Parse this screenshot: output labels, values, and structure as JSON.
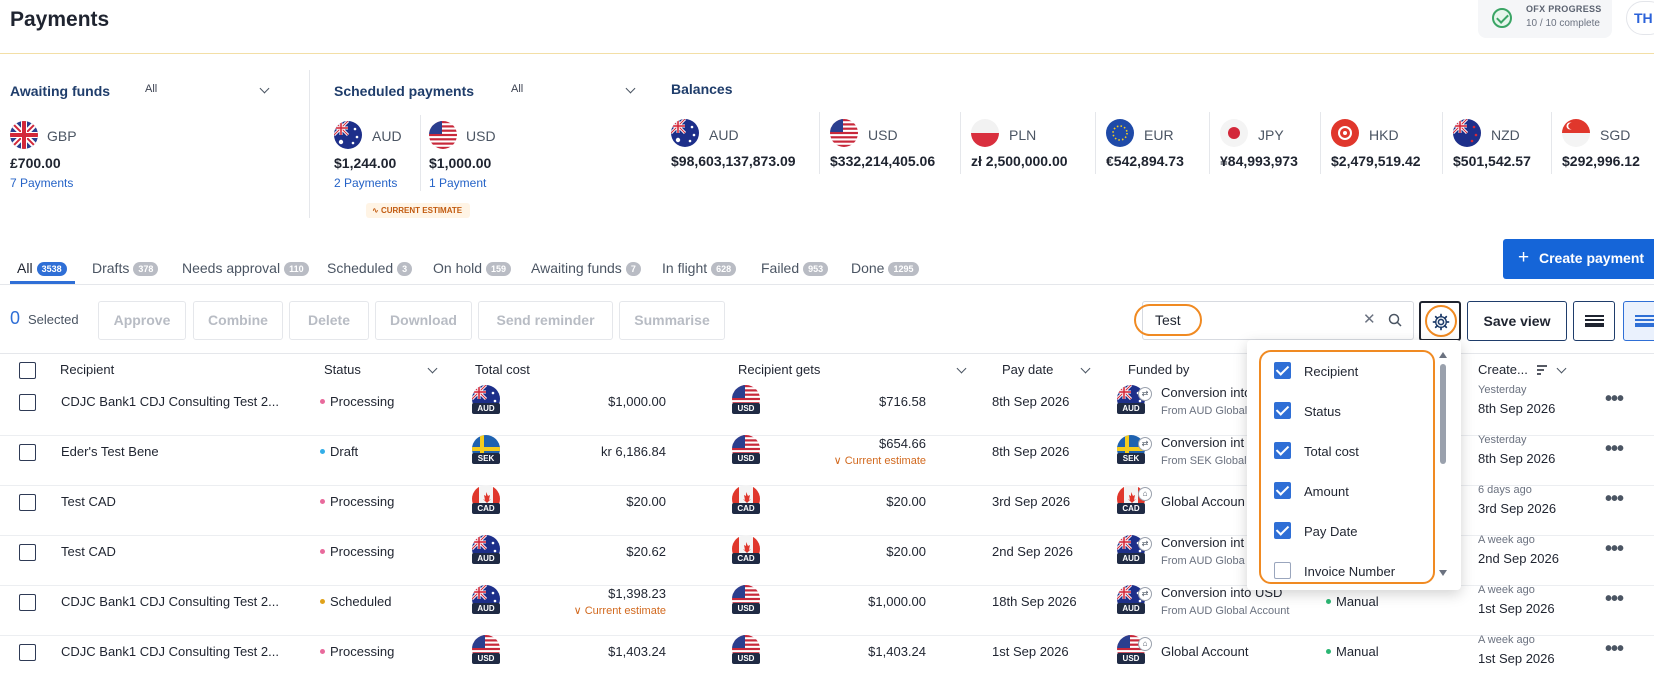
{
  "header": {
    "title": "Payments",
    "progress_title": "OFX PROGRESS",
    "progress_sub": "10 / 10 complete",
    "avatar": "TH"
  },
  "awaiting": {
    "label": "Awaiting funds",
    "filter": "All",
    "items": [
      {
        "currency": "GBP",
        "amount": "£700.00",
        "link": "7 Payments"
      }
    ]
  },
  "scheduled": {
    "label": "Scheduled payments",
    "filter": "All",
    "items": [
      {
        "currency": "AUD",
        "amount": "$1,244.00",
        "link": "2 Payments"
      },
      {
        "currency": "USD",
        "amount": "$1,000.00",
        "link": "1 Payment"
      }
    ],
    "estimate_badge": "CURRENT ESTIMATE"
  },
  "balances": {
    "label": "Balances",
    "items": [
      {
        "currency": "AUD",
        "amount": "$98,603,137,873.09"
      },
      {
        "currency": "USD",
        "amount": "$332,214,405.06"
      },
      {
        "currency": "PLN",
        "amount": "zł 2,500,000.00"
      },
      {
        "currency": "EUR",
        "amount": "€542,894.73"
      },
      {
        "currency": "JPY",
        "amount": "¥84,993,973"
      },
      {
        "currency": "HKD",
        "amount": "$2,479,519.42"
      },
      {
        "currency": "NZD",
        "amount": "$501,542.57"
      },
      {
        "currency": "SGD",
        "amount": "$292,996.12"
      }
    ]
  },
  "tabs": [
    {
      "label": "All",
      "count": "3538"
    },
    {
      "label": "Drafts",
      "count": "378"
    },
    {
      "label": "Needs approval",
      "count": "110"
    },
    {
      "label": "Scheduled",
      "count": "3"
    },
    {
      "label": "On hold",
      "count": "159"
    },
    {
      "label": "Awaiting funds",
      "count": "7"
    },
    {
      "label": "In flight",
      "count": "628"
    },
    {
      "label": "Failed",
      "count": "953"
    },
    {
      "label": "Done",
      "count": "1295"
    }
  ],
  "create_button": "Create payment",
  "toolbar": {
    "selected_count": "0",
    "selected_label": "Selected",
    "actions": [
      "Approve",
      "Combine",
      "Delete",
      "Download",
      "Send reminder",
      "Summarise"
    ],
    "search_value": "Test",
    "save_view": "Save view"
  },
  "columns": {
    "recipient": "Recipient",
    "status": "Status",
    "total_cost": "Total cost",
    "recipient_gets": "Recipient gets",
    "pay_date": "Pay date",
    "funded_by": "Funded by",
    "created": "Create..."
  },
  "column_menu": [
    {
      "label": "Recipient",
      "checked": true
    },
    {
      "label": "Status",
      "checked": true
    },
    {
      "label": "Total cost",
      "checked": true
    },
    {
      "label": "Amount",
      "checked": true
    },
    {
      "label": "Pay Date",
      "checked": true
    },
    {
      "label": "Invoice Number",
      "checked": false
    }
  ],
  "rows": [
    {
      "recipient": "CDJC Bank1 CDJ Consulting Test 2...",
      "status": "Processing",
      "status_color": "#e86a9c",
      "cost_ccy": "AUD",
      "cost": "$1,000.00",
      "cost_est": "",
      "gets_ccy": "USD",
      "gets": "$716.58",
      "gets_est": "",
      "pay_date": "8th Sep 2026",
      "funded_ccy": "AUD",
      "funded_icon": "exchange-icon",
      "funded": "Conversion into",
      "funded_sub": "From AUD Global",
      "funding_method": "",
      "created_rel": "Yesterday",
      "created_date": "8th Sep 2026"
    },
    {
      "recipient": "Eder's Test Bene",
      "status": "Draft",
      "status_color": "#33aee8",
      "cost_ccy": "SEK",
      "cost": "kr 6,186.84",
      "cost_est": "",
      "gets_ccy": "USD",
      "gets": "$654.66",
      "gets_est": "Current estimate",
      "pay_date": "8th Sep 2026",
      "funded_ccy": "SEK",
      "funded_icon": "exchange-icon",
      "funded": "Conversion int",
      "funded_sub": "From SEK Global",
      "funding_method": "",
      "created_rel": "Yesterday",
      "created_date": "8th Sep 2026"
    },
    {
      "recipient": "Test CAD",
      "status": "Processing",
      "status_color": "#e86a9c",
      "cost_ccy": "CAD",
      "cost": "$20.00",
      "cost_est": "",
      "gets_ccy": "CAD",
      "gets": "$20.00",
      "gets_est": "",
      "pay_date": "3rd Sep 2026",
      "funded_ccy": "CAD",
      "funded_icon": "bank-icon",
      "funded": "Global Accoun",
      "funded_sub": "",
      "funding_method": "",
      "created_rel": "6 days ago",
      "created_date": "3rd Sep 2026"
    },
    {
      "recipient": "Test CAD",
      "status": "Processing",
      "status_color": "#e86a9c",
      "cost_ccy": "AUD",
      "cost": "$20.62",
      "cost_est": "",
      "gets_ccy": "CAD",
      "gets": "$20.00",
      "gets_est": "",
      "pay_date": "2nd Sep 2026",
      "funded_ccy": "AUD",
      "funded_icon": "exchange-icon",
      "funded": "Conversion int",
      "funded_sub": "From AUD Globa",
      "funding_method": "",
      "created_rel": "A week ago",
      "created_date": "2nd Sep 2026"
    },
    {
      "recipient": "CDJC Bank1 CDJ Consulting Test 2...",
      "status": "Scheduled",
      "status_color": "#e0a21b",
      "cost_ccy": "AUD",
      "cost": "$1,398.23",
      "cost_est": "Current estimate",
      "gets_ccy": "USD",
      "gets": "$1,000.00",
      "gets_est": "",
      "pay_date": "18th Sep 2026",
      "funded_ccy": "AUD",
      "funded_icon": "exchange-icon",
      "funded": "Conversion into USD",
      "funded_sub": "From AUD Global Account",
      "funding_method": "Manual",
      "created_rel": "A week ago",
      "created_date": "1st Sep 2026"
    },
    {
      "recipient": "CDJC Bank1 CDJ Consulting Test 2...",
      "status": "Processing",
      "status_color": "#e86a9c",
      "cost_ccy": "USD",
      "cost": "$1,403.24",
      "cost_est": "",
      "gets_ccy": "USD",
      "gets": "$1,403.24",
      "gets_est": "",
      "pay_date": "1st Sep 2026",
      "funded_ccy": "USD",
      "funded_icon": "bank-icon",
      "funded": "Global Account",
      "funded_sub": "",
      "funding_method": "Manual",
      "created_rel": "A week ago",
      "created_date": "1st Sep 2026"
    }
  ],
  "colors": {
    "accent": "#1565d8",
    "highlight": "#f08a22",
    "navy": "#1f3d6b"
  }
}
